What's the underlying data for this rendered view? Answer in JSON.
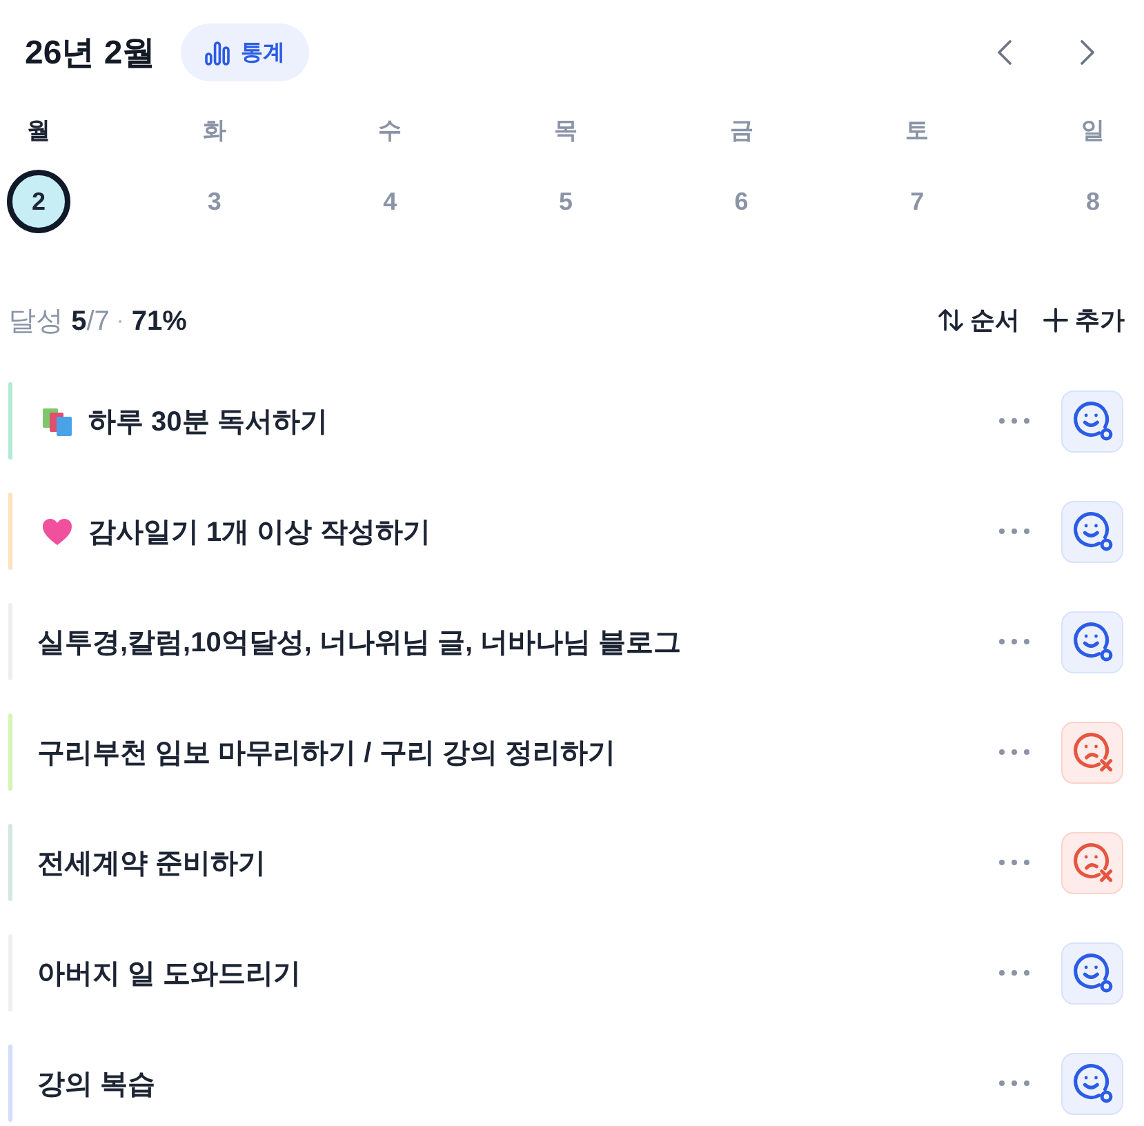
{
  "header": {
    "title": "26년 2월",
    "stats_button": {
      "label": "통계"
    }
  },
  "week": [
    {
      "weekday": "월",
      "date": "2",
      "selected": true
    },
    {
      "weekday": "화",
      "date": "3",
      "selected": false
    },
    {
      "weekday": "수",
      "date": "4",
      "selected": false
    },
    {
      "weekday": "목",
      "date": "5",
      "selected": false
    },
    {
      "weekday": "금",
      "date": "6",
      "selected": false
    },
    {
      "weekday": "토",
      "date": "7",
      "selected": false
    },
    {
      "weekday": "일",
      "date": "8",
      "selected": false
    }
  ],
  "summary": {
    "label": "달성",
    "done": "5",
    "total": "/7",
    "separator": "·",
    "percent": "71%"
  },
  "actions": [
    {
      "kind": "sort",
      "label": "순서"
    },
    {
      "kind": "add",
      "label": "추가"
    }
  ],
  "tasks": [
    {
      "kind": "books",
      "title": "하루 30분 독서하기",
      "color": "#b3ead5",
      "done": true
    },
    {
      "kind": "heart",
      "title": "감사일기 1개 이상 작성하기",
      "color": "#fde2bd",
      "done": true
    },
    {
      "kind": "plain",
      "title": "실투경,칼럼,10억달성, 너나위님 글, 너바나님 블로그",
      "color": "#eeeeee",
      "done": true
    },
    {
      "kind": "plain",
      "title": "구리부천 임보 마무리하기 / 구리 강의 정리하기",
      "color": "#d6f5b4",
      "done": false
    },
    {
      "kind": "plain",
      "title": "전세계약 준비하기",
      "color": "#d2e7df",
      "done": false
    },
    {
      "kind": "plain",
      "title": "아버지 일 도와드리기",
      "color": "#efefef",
      "done": true
    },
    {
      "kind": "plain",
      "title": "강의 복습",
      "color": "#d4ddf8",
      "done": true
    }
  ]
}
